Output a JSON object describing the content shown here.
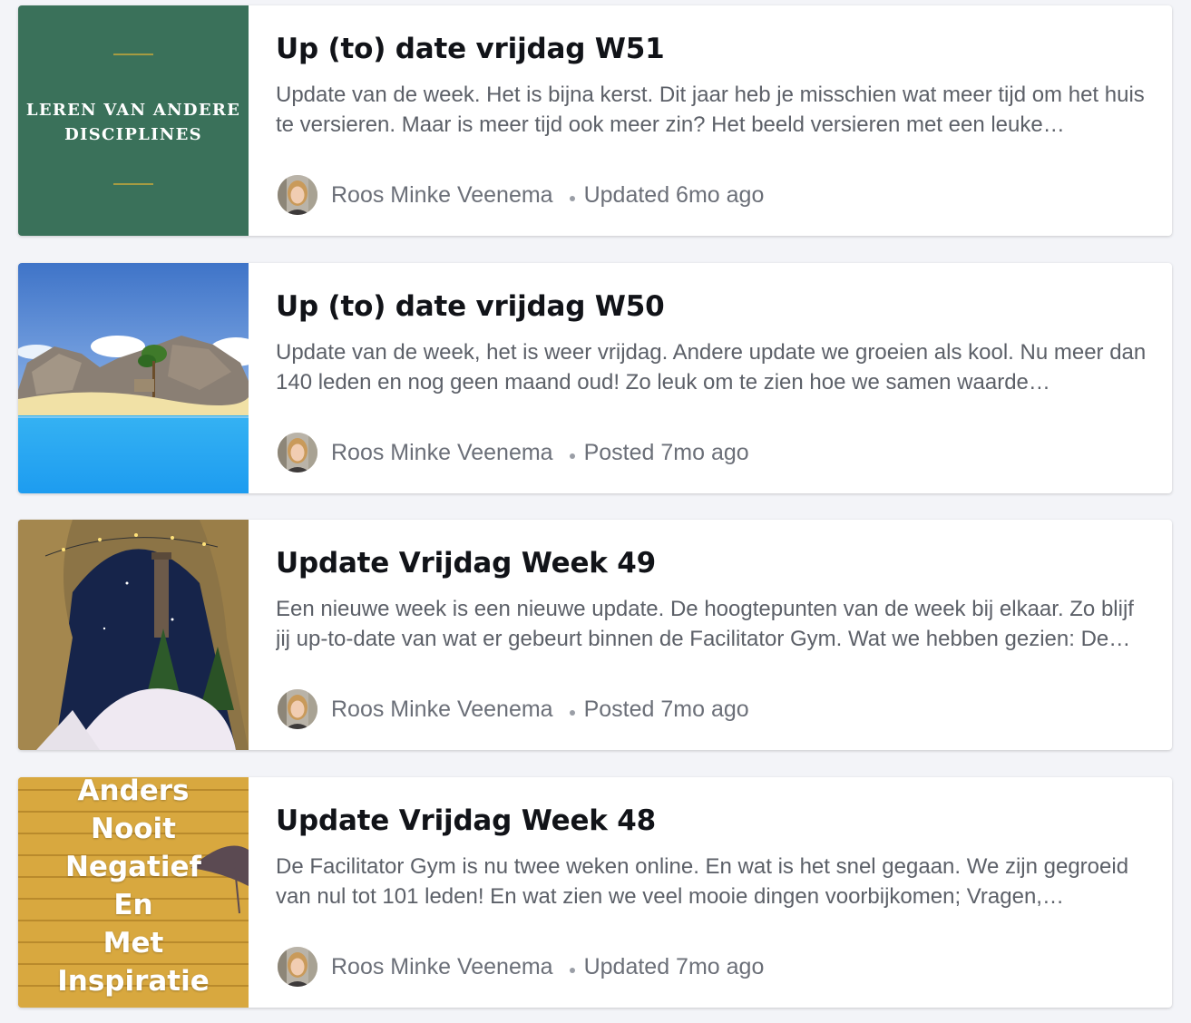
{
  "posts": [
    {
      "title": "Up (to) date vrijdag W51",
      "excerpt": "Update van de week. Het is bijna kerst. Dit jaar heb je misschien wat meer tijd om het huis te versieren. Maar is meer tijd ook meer zin? Het beeld versieren met een leuke…",
      "author": "Roos Minke Veenema",
      "status": "Updated 6mo ago",
      "thumb_lines": [
        "LEREN VAN ANDERE",
        "DISCIPLINES"
      ],
      "thumb_bg": "#3a715a"
    },
    {
      "title": "Up (to) date vrijdag W50",
      "excerpt": "Update van de week, het is weer vrijdag. Andere update we groeien als kool. Nu meer dan 140 leden en nog geen maand oud! Zo leuk om te zien hoe we samen waarde…",
      "author": "Roos Minke Veenema",
      "status": "Posted 7mo ago"
    },
    {
      "title": "Update Vrijdag Week 49",
      "excerpt": "Een nieuwe week is een nieuwe update. De hoogtepunten van de week bij elkaar. Zo blijf jij up-to-date van wat er gebeurt binnen de Facilitator Gym.   Wat we hebben gezien: De…",
      "author": "Roos Minke Veenema",
      "status": "Posted 7mo ago"
    },
    {
      "title": "Update Vrijdag Week 48",
      "excerpt": "De Facilitator Gym is nu twee weken online. En wat is het snel gegaan. We zijn gegroeid van nul tot 101 leden! En wat zien we veel mooie dingen voorbijkomen; Vragen,…",
      "author": "Roos Minke Veenema",
      "status": "Updated 7mo ago",
      "thumb_lines": [
        "Anders",
        "Nooit",
        "Negatief",
        "En",
        "Met",
        "Inspiratie"
      ],
      "thumb_bg": "#d6a53d"
    }
  ],
  "colors": {
    "background": "#f3f4f8",
    "card": "#ffffff",
    "title": "#111318",
    "muted": "#6b6f78"
  }
}
